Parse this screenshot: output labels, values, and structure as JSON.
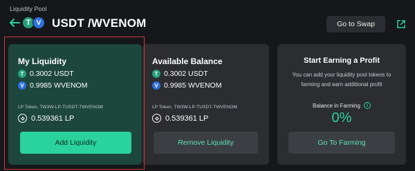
{
  "header": {
    "breadcrumb": "Liquidity Pool",
    "pair_title": "USDT /WVENOM",
    "swap_button": "Go to Swap"
  },
  "colors": {
    "accent": "#2ad39b",
    "my_card_bg": "#1d473c",
    "card_bg": "#2b2d31",
    "highlight": "#d03a3a"
  },
  "my_liquidity": {
    "title": "My Liquidity",
    "token_a": "0.3002 USDT",
    "token_b": "0.9985 WVENOM",
    "lp_label": "LP Token, TW3W-LP-TUSDT-TWVENOM",
    "lp_amount": "0.539361 LP",
    "button": "Add Liquidity"
  },
  "available_balance": {
    "title": "Available Balance",
    "token_a": "0.3002 USDT",
    "token_b": "0.9985 WVENOM",
    "lp_label": "LP Token, TW3W-LP-TUSDT-TWVENOM",
    "lp_amount": "0.539361 LP",
    "button": "Remove Liquidity"
  },
  "earning": {
    "title": "Start Earning a Profit",
    "description": "You can add your liquidity pool tokens to farming and earn additional profit",
    "farming_label": "Balance in Farming",
    "farming_value": "0%",
    "button": "Go To Farming"
  }
}
